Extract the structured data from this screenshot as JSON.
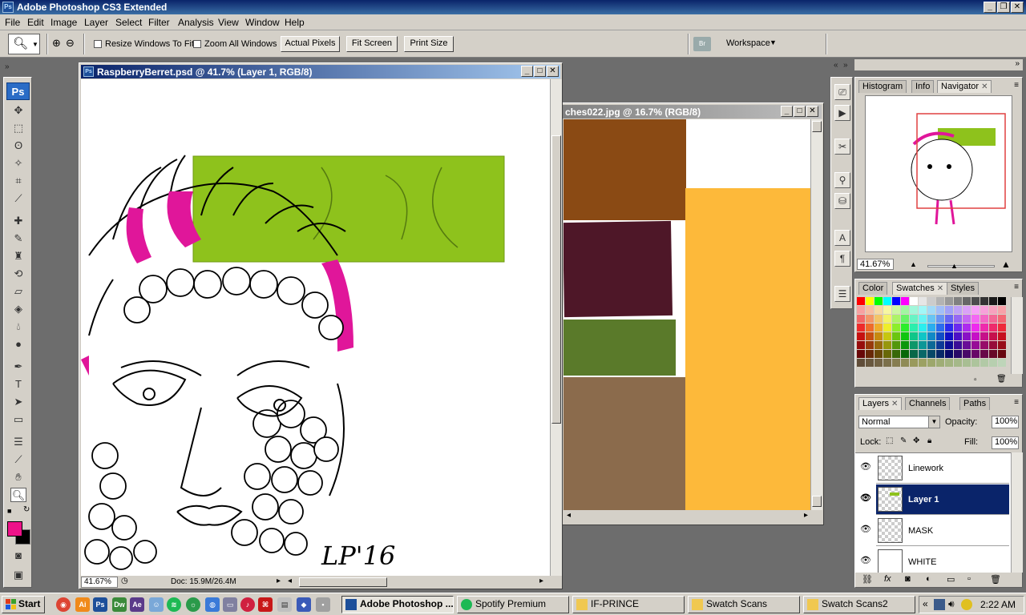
{
  "app": {
    "title": "Adobe Photoshop CS3 Extended",
    "badge": "Ps"
  },
  "menu": [
    "File",
    "Edit",
    "Image",
    "Layer",
    "Select",
    "Filter",
    "Analysis",
    "View",
    "Window",
    "Help"
  ],
  "options": {
    "resize_windows": "Resize Windows To Fit",
    "zoom_all": "Zoom All Windows",
    "actual_pixels": "Actual Pixels",
    "fit_screen": "Fit Screen",
    "print_size": "Print Size",
    "workspace": "Workspace"
  },
  "tools": {
    "logo": "Ps",
    "fg_color": "#ee1289",
    "bg_color": "#000000"
  },
  "doc1": {
    "title": "RaspberryBerret.psd @ 41.7% (Layer 1, RGB/8)",
    "zoom": "41.67%",
    "doc_info": "Doc: 15.9M/26.4M",
    "signature": "LP'16"
  },
  "doc2": {
    "title": "ches022.jpg @ 16.7% (RGB/8)"
  },
  "navigator": {
    "tabs": [
      "Histogram",
      "Info",
      "Navigator"
    ],
    "zoom": "41.67%"
  },
  "swatches": {
    "tabs": [
      "Color",
      "Swatches",
      "Styles"
    ],
    "top_row": [
      "#ff0000",
      "#ffff00",
      "#00ff00",
      "#00ffff",
      "#0000ff",
      "#ff00ff",
      "#ffffff",
      "#e6e6e6",
      "#cccccc",
      "#b3b3b3",
      "#999999",
      "#808080",
      "#666666",
      "#4d4d4d",
      "#333333",
      "#1a1a1a",
      "#000000"
    ]
  },
  "layers": {
    "tabs": [
      "Layers",
      "Channels",
      "Paths"
    ],
    "blend_mode": "Normal",
    "opacity_label": "Opacity:",
    "opacity": "100%",
    "lock_label": "Lock:",
    "fill_label": "Fill:",
    "fill": "100%",
    "items": [
      {
        "name": "Linework",
        "selected": false
      },
      {
        "name": "Layer 1",
        "selected": true
      },
      {
        "name": "MASK",
        "selected": false
      },
      {
        "name": "WHITE",
        "selected": false
      }
    ]
  },
  "taskbar": {
    "start": "Start",
    "tasks": [
      "Adobe Photoshop ...",
      "Spotify Premium",
      "IF-PRINCE",
      "Swatch Scans",
      "Swatch Scans2"
    ],
    "clock": "2:22 AM"
  }
}
